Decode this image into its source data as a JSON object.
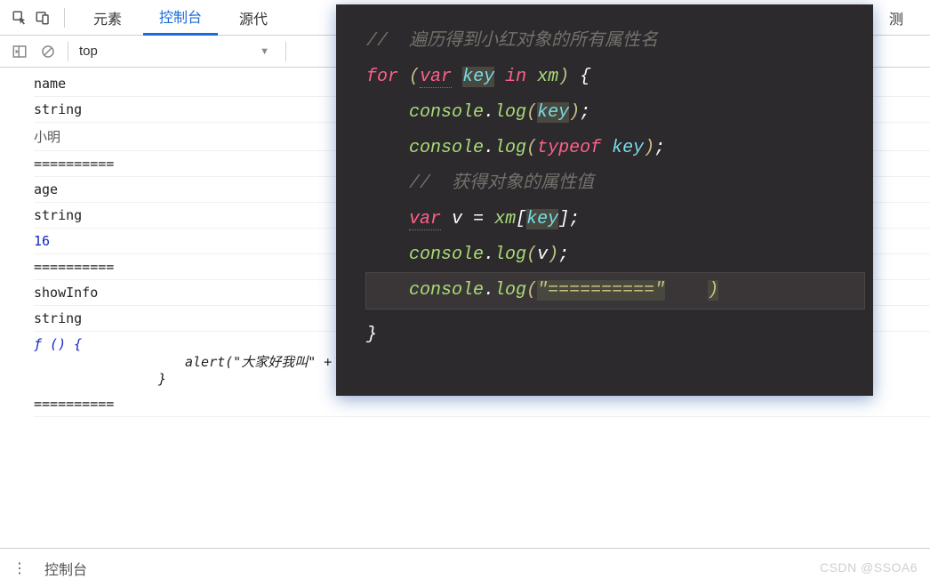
{
  "tabs": {
    "elements": "元素",
    "console": "控制台",
    "sources_partial": "源代",
    "right_partial": "测"
  },
  "toolbar": {
    "scope": "top"
  },
  "console_output": [
    {
      "text": "name",
      "cls": ""
    },
    {
      "text": "string",
      "cls": ""
    },
    {
      "text": "小明",
      "cls": "cn"
    },
    {
      "text": "==========",
      "cls": ""
    },
    {
      "text": "age",
      "cls": ""
    },
    {
      "text": "string",
      "cls": ""
    },
    {
      "text": "16",
      "cls": "blue"
    },
    {
      "text": "==========",
      "cls": ""
    },
    {
      "text": "showInfo",
      "cls": ""
    },
    {
      "text": "string",
      "cls": ""
    }
  ],
  "fn_output": {
    "head": "ƒ () {",
    "body": "alert(\"大家好我叫\" + this.name + \"今年\" + this.age + \"岁了\");",
    "close": "}"
  },
  "trailing_sep": "==========",
  "editor": {
    "line1_comment": "//  遍历得到小红对象的所有属性名",
    "line2": {
      "for": "for",
      "var": "var",
      "key": "key",
      "in": "in",
      "xm": "xm"
    },
    "line3": {
      "console": "console",
      "log": "log",
      "arg": "key"
    },
    "line4": {
      "console": "console",
      "log": "log",
      "typeof": "typeof",
      "arg": "key"
    },
    "line5_comment": "//  获得对象的属性值",
    "line6": {
      "var": "var",
      "v": "v",
      "xm": "xm",
      "key": "key"
    },
    "line7": {
      "console": "console",
      "log": "log",
      "arg": "v"
    },
    "line8": {
      "console": "console",
      "log": "log",
      "str": "\"==========\""
    }
  },
  "drawer": {
    "title": "控制台",
    "menu_glyph": "⋮"
  },
  "watermark": "CSDN @SSOA6"
}
